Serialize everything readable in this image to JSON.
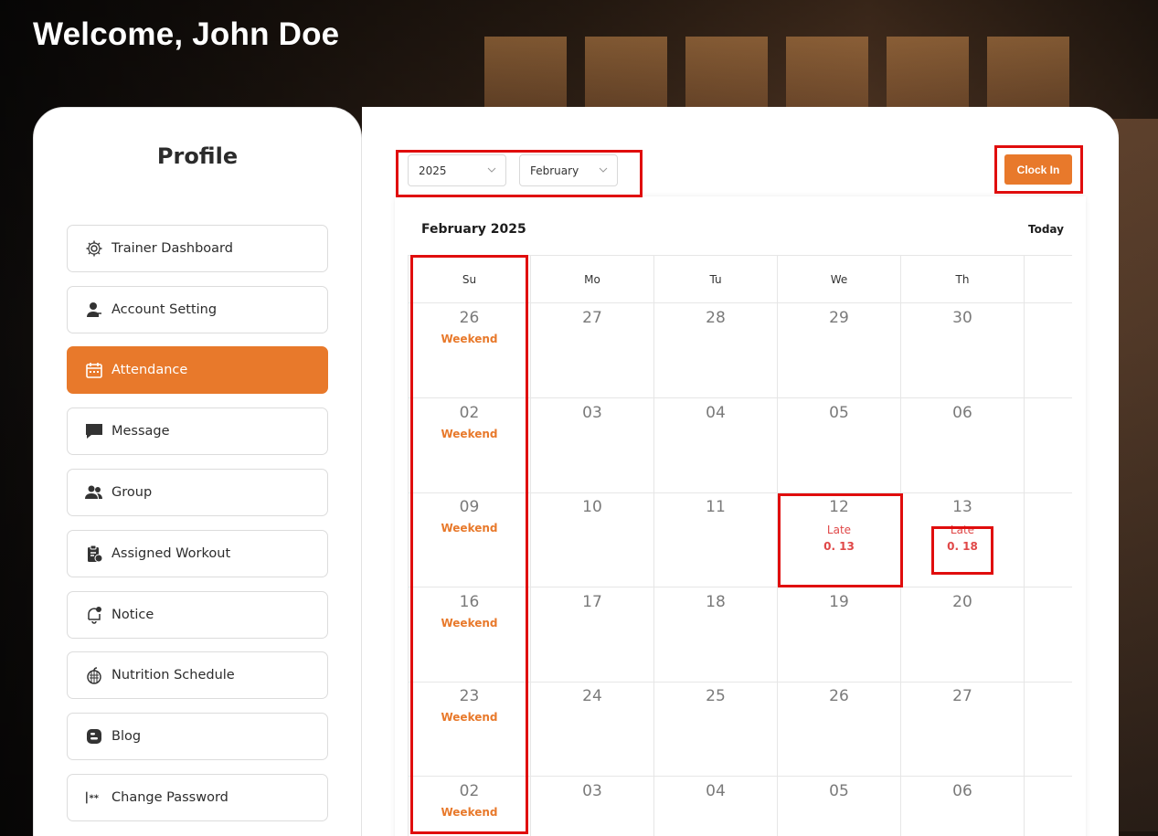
{
  "header": {
    "welcome": "Welcome, John Doe"
  },
  "sidebar": {
    "title": "Profile",
    "items": [
      {
        "label": "Trainer Dashboard",
        "icon": "gear-icon",
        "active": false
      },
      {
        "label": "Account Setting",
        "icon": "user-edit-icon",
        "active": false
      },
      {
        "label": "Attendance",
        "icon": "calendar-icon",
        "active": true
      },
      {
        "label": "Message",
        "icon": "message-icon",
        "active": false
      },
      {
        "label": "Group",
        "icon": "group-icon",
        "active": false
      },
      {
        "label": "Assigned Workout",
        "icon": "clipboard-icon",
        "active": false
      },
      {
        "label": "Notice",
        "icon": "bell-icon",
        "active": false
      },
      {
        "label": "Nutrition Schedule",
        "icon": "apple-icon",
        "active": false
      },
      {
        "label": "Blog",
        "icon": "blog-icon",
        "active": false
      },
      {
        "label": "Change Password",
        "icon": "password-icon",
        "active": false
      }
    ]
  },
  "filters": {
    "year": "2025",
    "month": "February"
  },
  "actions": {
    "clock_in": "Clock In"
  },
  "calendar": {
    "title": "February 2025",
    "today_label": "Today",
    "weekdays": [
      "Su",
      "Mo",
      "Tu",
      "We",
      "Th"
    ],
    "weeks": [
      [
        {
          "day": "26",
          "note": "Weekend"
        },
        {
          "day": "27"
        },
        {
          "day": "28"
        },
        {
          "day": "29"
        },
        {
          "day": "30"
        }
      ],
      [
        {
          "day": "02",
          "note": "Weekend"
        },
        {
          "day": "03"
        },
        {
          "day": "04"
        },
        {
          "day": "05"
        },
        {
          "day": "06"
        }
      ],
      [
        {
          "day": "09",
          "note": "Weekend"
        },
        {
          "day": "10"
        },
        {
          "day": "11"
        },
        {
          "day": "12",
          "note": "Late",
          "time": "0. 13"
        },
        {
          "day": "13",
          "note": "Late",
          "time": "0. 18"
        }
      ],
      [
        {
          "day": "16",
          "note": "Weekend"
        },
        {
          "day": "17"
        },
        {
          "day": "18"
        },
        {
          "day": "19"
        },
        {
          "day": "20"
        }
      ],
      [
        {
          "day": "23",
          "note": "Weekend"
        },
        {
          "day": "24"
        },
        {
          "day": "25"
        },
        {
          "day": "26"
        },
        {
          "day": "27"
        }
      ],
      [
        {
          "day": "02",
          "note": "Weekend"
        },
        {
          "day": "03"
        },
        {
          "day": "04"
        },
        {
          "day": "05"
        },
        {
          "day": "06"
        }
      ]
    ]
  },
  "colors": {
    "accent": "#e8792b",
    "late": "#e04848",
    "highlight": "#e00d0d"
  }
}
